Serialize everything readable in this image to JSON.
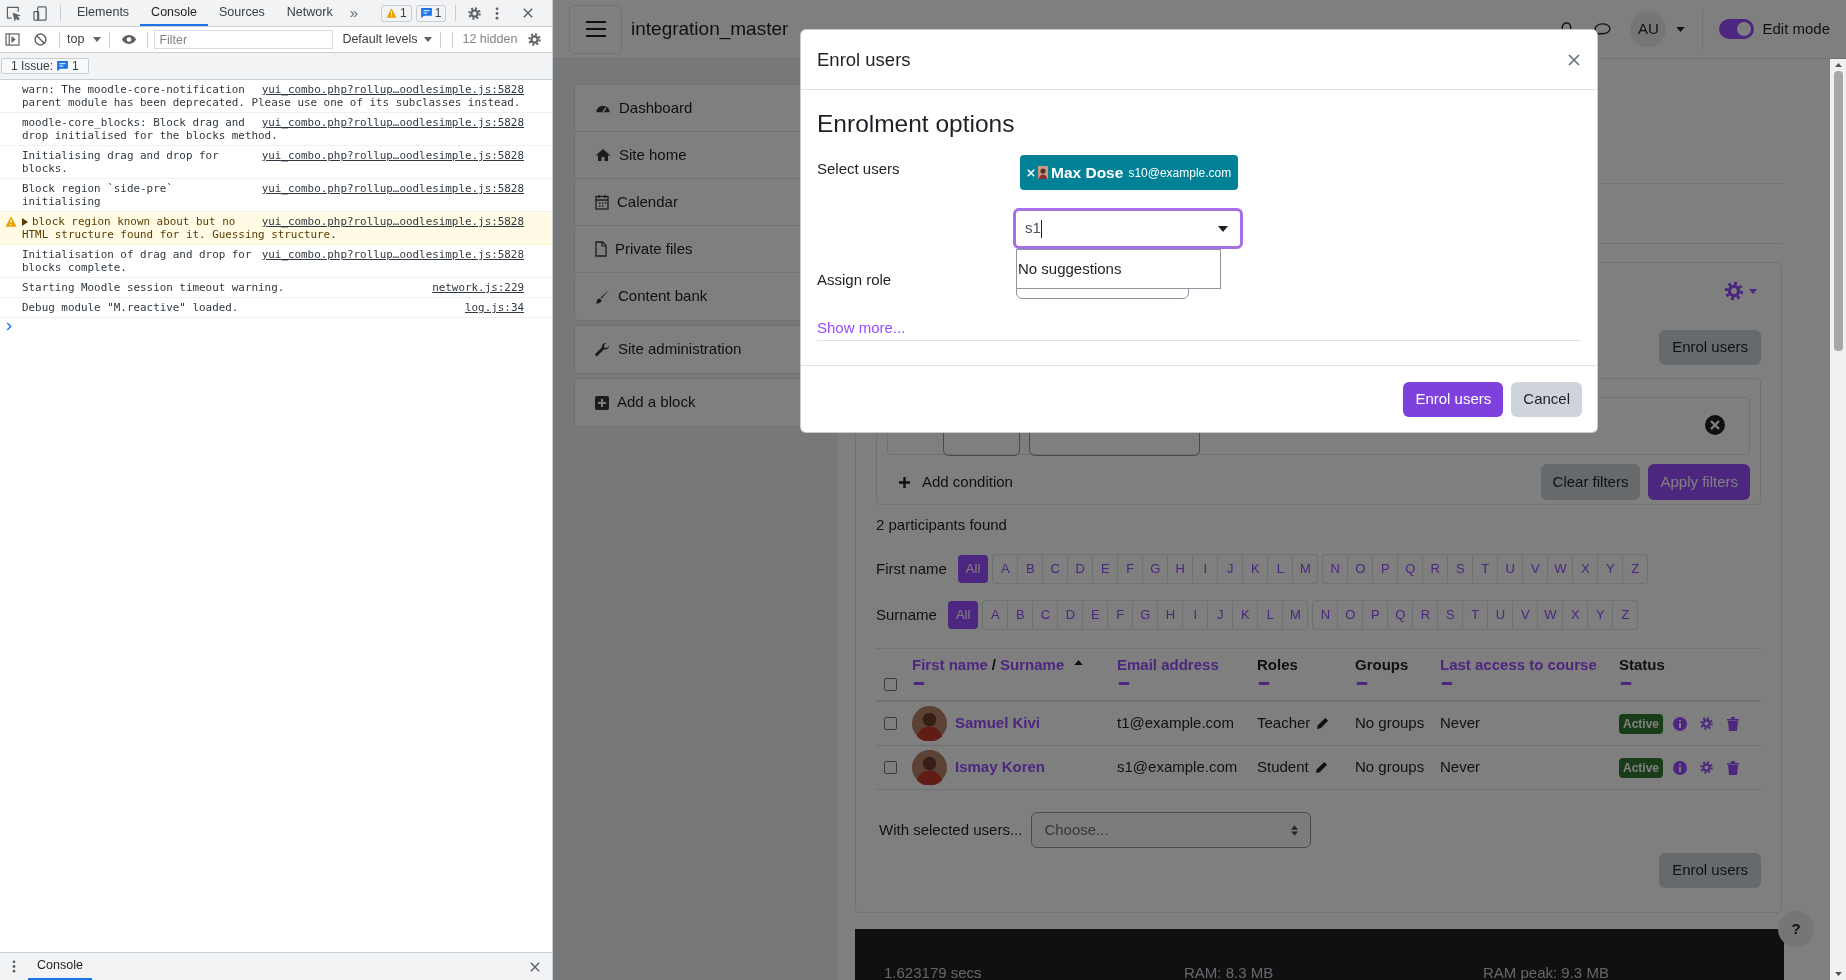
{
  "devtools": {
    "tabs": [
      {
        "label": "Elements",
        "selected": false
      },
      {
        "label": "Console",
        "selected": true
      },
      {
        "label": "Sources",
        "selected": false
      },
      {
        "label": "Network",
        "selected": false
      }
    ],
    "more": "»",
    "warning_count": "1",
    "info_count": "1",
    "context": "top",
    "filter": {
      "placeholder": "Filter"
    },
    "levels": "Default levels",
    "hidden": "12 hidden",
    "issues": {
      "label": "1 Issue:",
      "count": "1"
    },
    "messages": [
      {
        "kind": "log",
        "lines": [
          "warn: The moodle-core-notification",
          "parent module has been deprecated. Please use one of its subclasses instead."
        ],
        "source": "yui_combo.php?rollup…oodlesimple.js:5828"
      },
      {
        "kind": "log",
        "lines": [
          "moodle-core_blocks: Block drag and",
          "drop initialised for the blocks method."
        ],
        "source": "yui_combo.php?rollup…oodlesimple.js:5828"
      },
      {
        "kind": "log",
        "lines": [
          "Initialising drag and drop for",
          "blocks."
        ],
        "source": "yui_combo.php?rollup…oodlesimple.js:5828"
      },
      {
        "kind": "log",
        "lines": [
          "Block region `side-pre`",
          "initialising"
        ],
        "source": "yui_combo.php?rollup…oodlesimple.js:5828"
      },
      {
        "kind": "warning",
        "lines": [
          "block region known about but no",
          "HTML structure found for it. Guessing structure."
        ],
        "source": "yui_combo.php?rollup…oodlesimple.js:5828"
      },
      {
        "kind": "log",
        "lines": [
          "Initialisation of drag and drop for",
          "blocks complete."
        ],
        "source": "yui_combo.php?rollup…oodlesimple.js:5828"
      },
      {
        "kind": "log",
        "lines": [
          "Starting Moodle session timeout warning."
        ],
        "source": "network.js:229"
      },
      {
        "kind": "log",
        "lines": [
          "Debug module \"M.reactive\" loaded."
        ],
        "source": "log.js:34"
      }
    ],
    "drawer_tabs": [
      {
        "label": "Console",
        "selected": true
      }
    ]
  },
  "navbar": {
    "site_name": "integration_master",
    "avatar": "AU",
    "edit_mode": {
      "label": "Edit mode",
      "on": true
    }
  },
  "blocks": [
    {
      "items": [
        "Dashboard",
        "Site home",
        "Calendar",
        "Private files",
        "Content bank"
      ]
    },
    {
      "items": [
        "Site administration"
      ]
    },
    {
      "items": [
        "Add a block"
      ]
    }
  ],
  "participants": {
    "enrol_button": "Enrol users",
    "add_condition": "Add condition",
    "clear_filters": "Clear filters",
    "apply_filters": "Apply filters",
    "found": "2 participants found",
    "initials": [
      {
        "label": "First name",
        "letters": [
          {
            "label": "All",
            "selected": true
          },
          {
            "label": "A",
            "selected": false
          },
          {
            "label": "B",
            "selected": false
          },
          {
            "label": "C",
            "selected": false
          },
          {
            "label": "D",
            "selected": false
          },
          {
            "label": "E",
            "selected": false
          },
          {
            "label": "F",
            "selected": false
          },
          {
            "label": "G",
            "selected": false
          },
          {
            "label": "H",
            "selected": false
          },
          {
            "label": "I",
            "selected": false
          },
          {
            "label": "J",
            "selected": false
          },
          {
            "label": "K",
            "selected": false
          },
          {
            "label": "L",
            "selected": false
          },
          {
            "label": "M",
            "selected": false
          },
          {
            "label": "N",
            "selected": false
          },
          {
            "label": "O",
            "selected": false
          },
          {
            "label": "P",
            "selected": false
          },
          {
            "label": "Q",
            "selected": false
          },
          {
            "label": "R",
            "selected": false
          },
          {
            "label": "S",
            "selected": false
          },
          {
            "label": "T",
            "selected": false
          },
          {
            "label": "U",
            "selected": false
          },
          {
            "label": "V",
            "selected": false
          },
          {
            "label": "W",
            "selected": false
          },
          {
            "label": "X",
            "selected": false
          },
          {
            "label": "Y",
            "selected": false
          },
          {
            "label": "Z",
            "selected": false
          }
        ]
      },
      {
        "label": "Surname",
        "letters": [
          {
            "label": "All",
            "selected": true
          },
          {
            "label": "A",
            "selected": false
          },
          {
            "label": "B",
            "selected": false
          },
          {
            "label": "C",
            "selected": false
          },
          {
            "label": "D",
            "selected": false
          },
          {
            "label": "E",
            "selected": false
          },
          {
            "label": "F",
            "selected": false
          },
          {
            "label": "G",
            "selected": false
          },
          {
            "label": "H",
            "selected": false
          },
          {
            "label": "I",
            "selected": false
          },
          {
            "label": "J",
            "selected": false
          },
          {
            "label": "K",
            "selected": false
          },
          {
            "label": "L",
            "selected": false
          },
          {
            "label": "M",
            "selected": false
          },
          {
            "label": "N",
            "selected": false
          },
          {
            "label": "O",
            "selected": false
          },
          {
            "label": "P",
            "selected": false
          },
          {
            "label": "Q",
            "selected": false
          },
          {
            "label": "R",
            "selected": false
          },
          {
            "label": "S",
            "selected": false
          },
          {
            "label": "T",
            "selected": false
          },
          {
            "label": "U",
            "selected": false
          },
          {
            "label": "V",
            "selected": false
          },
          {
            "label": "W",
            "selected": false
          },
          {
            "label": "X",
            "selected": false
          },
          {
            "label": "Y",
            "selected": false
          },
          {
            "label": "Z",
            "selected": false
          }
        ]
      }
    ],
    "columns": [
      {
        "kind": "name",
        "first": "First name",
        "separator": "/",
        "second": "Surname",
        "sorted": true
      },
      {
        "kind": "link",
        "label": "Email address"
      },
      {
        "kind": "plain",
        "label": "Roles"
      },
      {
        "kind": "plain",
        "label": "Groups"
      },
      {
        "kind": "link",
        "label": "Last access to course"
      },
      {
        "kind": "plain",
        "label": "Status"
      }
    ],
    "select_all_checked": false,
    "rows": [
      {
        "name": "Samuel Kivi",
        "email": "t1@example.com",
        "role": "Teacher",
        "groups": "No groups",
        "last_access": "Never",
        "status": "Active",
        "checked": false
      },
      {
        "name": "Ismay Koren",
        "email": "s1@example.com",
        "role": "Student",
        "groups": "No groups",
        "last_access": "Never",
        "status": "Active",
        "checked": false
      }
    ],
    "with_selected": "With selected users...",
    "action_select": {
      "placeholder": "Choose..."
    },
    "enrol_button_bottom": "Enrol users"
  },
  "footer": [
    "1.623179 secs",
    "RAM: 8.3 MB",
    "RAM peak: 9.3 MB"
  ],
  "help": "?",
  "modal": {
    "title": "Enrol users",
    "heading": "Enrolment options",
    "select_users_label": "Select users",
    "selected": [
      {
        "name": "Max Dose",
        "email": "s10@example.com"
      }
    ],
    "search": {
      "value": "s1"
    },
    "suggestions": "No suggestions",
    "assign_role_label": "Assign role",
    "show_more": "Show more...",
    "buttons": [
      {
        "label": "Enrol users",
        "kind": "primary"
      },
      {
        "label": "Cancel",
        "kind": "secondary"
      }
    ]
  }
}
